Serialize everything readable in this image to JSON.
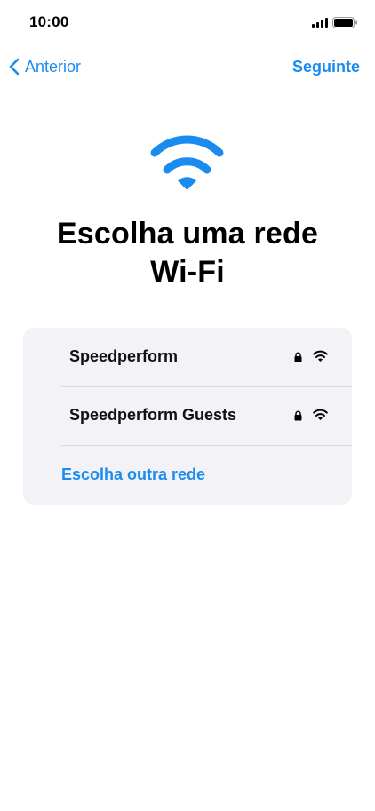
{
  "status_bar": {
    "time": "10:00"
  },
  "nav": {
    "back_label": "Anterior",
    "next_label": "Seguinte"
  },
  "header": {
    "title_line1": "Escolha uma rede",
    "title_line2": "Wi-Fi",
    "hero_icon": "wifi-icon"
  },
  "networks": [
    {
      "name": "Speedperform",
      "secured": true,
      "icon": "wifi-icon"
    },
    {
      "name": "Speedperform Guests",
      "secured": true,
      "icon": "wifi-icon"
    }
  ],
  "other_network_label": "Escolha outra rede",
  "colors": {
    "accent": "#1a8cf0",
    "card_bg": "#f2f2f7",
    "background": "#ffffff"
  }
}
